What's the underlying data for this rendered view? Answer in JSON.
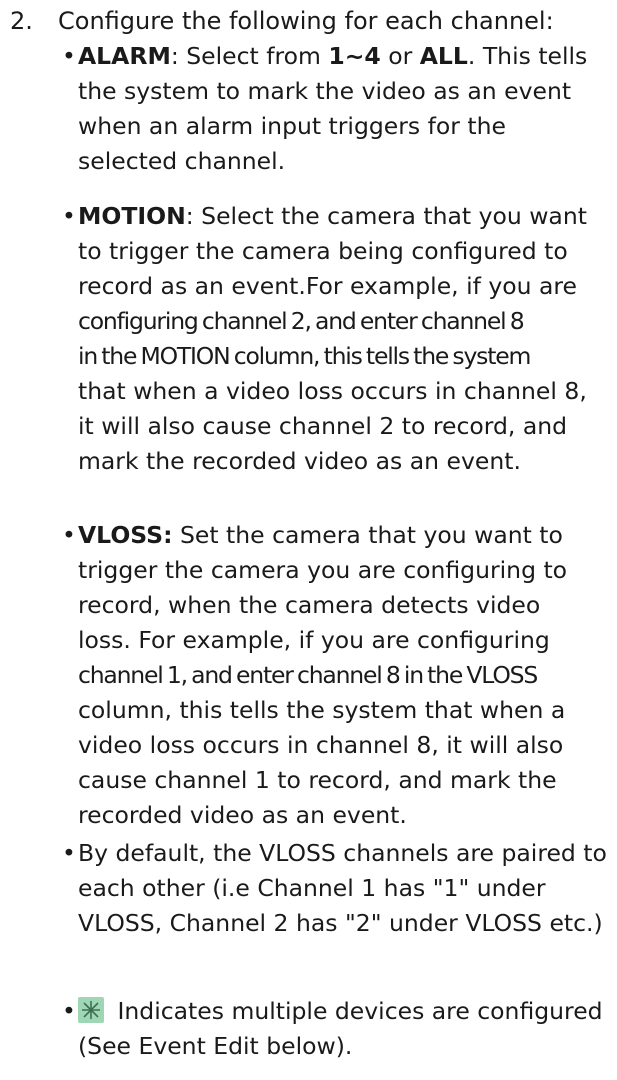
{
  "step": {
    "number": "2.",
    "text": "Configure the following for each channel:"
  },
  "items": [
    {
      "term": "ALARM",
      "after_term": ": Select from ",
      "range": "1~4",
      "or_word": " or ",
      "all_word": "ALL",
      "body": ". This tells the system to mark the video as an event when an alarm input triggers for the selected channel."
    },
    {
      "term": "MOTION",
      "lines": [
        ": Select the camera that you want",
        "to trigger the camera being configured to",
        "record as an event.For example, if you are",
        "configuring channel 2, and enter channel 8",
        "in the MOTION column, this tells the system",
        "that when a video loss occurs in channel 8,",
        "it will also cause channel 2 to record, and",
        "mark the recorded video as an event."
      ]
    },
    {
      "term": "VLOSS:",
      "lines": [
        " Set the camera that you want to",
        "trigger the camera you are configuring to",
        "record, when the camera detects video",
        "loss. For example, if you are configuring",
        "channel 1, and enter channel 8 in the VLOSS",
        "column, this tells the system that when a",
        "video loss occurs in channel 8, it will also",
        "cause channel 1 to record, and mark the",
        "recorded video as an event."
      ]
    },
    {
      "text": "By default, the VLOSS channels are paired to each other (i.e Channel 1 has \"1\" under VLOSS, Channel 2 has \"2\" under VLOSS etc.)"
    },
    {
      "icon": "multiple-devices-icon",
      "text": " Indicates multiple devices are configured (See Event Edit below)."
    }
  ],
  "colors": {
    "text": "#1a1a1a",
    "icon_bg": "#9fd6b3",
    "icon_fg": "#3f6f52"
  }
}
